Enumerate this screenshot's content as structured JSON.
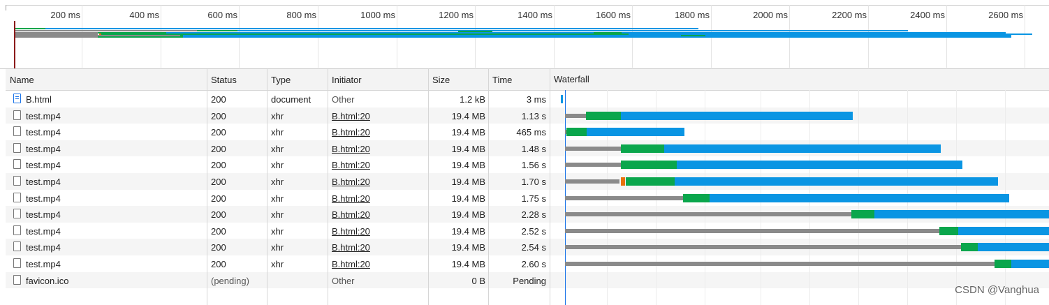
{
  "overview": {
    "ticks": [
      "200 ms",
      "400 ms",
      "600 ms",
      "800 ms",
      "1000 ms",
      "1200 ms",
      "1400 ms",
      "1600 ms",
      "1800 ms",
      "2000 ms",
      "2200 ms",
      "2400 ms",
      "2600 ms"
    ]
  },
  "table": {
    "headers": {
      "name": "Name",
      "status": "Status",
      "type": "Type",
      "initiator": "Initiator",
      "size": "Size",
      "time": "Time",
      "waterfall": "Waterfall"
    },
    "rows": [
      {
        "name": "B.html",
        "status": "200",
        "type": "document",
        "initiator": "Other",
        "initiator_link": false,
        "size": "1.2 kB",
        "time": "3 ms",
        "icon": "document-icon"
      },
      {
        "name": "test.mp4",
        "status": "200",
        "type": "xhr",
        "initiator": "B.html:20",
        "initiator_link": true,
        "size": "19.4 MB",
        "time": "1.13 s",
        "icon": "file-icon"
      },
      {
        "name": "test.mp4",
        "status": "200",
        "type": "xhr",
        "initiator": "B.html:20",
        "initiator_link": true,
        "size": "19.4 MB",
        "time": "465 ms",
        "icon": "file-icon"
      },
      {
        "name": "test.mp4",
        "status": "200",
        "type": "xhr",
        "initiator": "B.html:20",
        "initiator_link": true,
        "size": "19.4 MB",
        "time": "1.48 s",
        "icon": "file-icon"
      },
      {
        "name": "test.mp4",
        "status": "200",
        "type": "xhr",
        "initiator": "B.html:20",
        "initiator_link": true,
        "size": "19.4 MB",
        "time": "1.56 s",
        "icon": "file-icon"
      },
      {
        "name": "test.mp4",
        "status": "200",
        "type": "xhr",
        "initiator": "B.html:20",
        "initiator_link": true,
        "size": "19.4 MB",
        "time": "1.70 s",
        "icon": "file-icon"
      },
      {
        "name": "test.mp4",
        "status": "200",
        "type": "xhr",
        "initiator": "B.html:20",
        "initiator_link": true,
        "size": "19.4 MB",
        "time": "1.75 s",
        "icon": "file-icon"
      },
      {
        "name": "test.mp4",
        "status": "200",
        "type": "xhr",
        "initiator": "B.html:20",
        "initiator_link": true,
        "size": "19.4 MB",
        "time": "2.28 s",
        "icon": "file-icon"
      },
      {
        "name": "test.mp4",
        "status": "200",
        "type": "xhr",
        "initiator": "B.html:20",
        "initiator_link": true,
        "size": "19.4 MB",
        "time": "2.52 s",
        "icon": "file-icon"
      },
      {
        "name": "test.mp4",
        "status": "200",
        "type": "xhr",
        "initiator": "B.html:20",
        "initiator_link": true,
        "size": "19.4 MB",
        "time": "2.54 s",
        "icon": "file-icon"
      },
      {
        "name": "test.mp4",
        "status": "200",
        "type": "xhr",
        "initiator": "B.html:20",
        "initiator_link": true,
        "size": "19.4 MB",
        "time": "2.60 s",
        "icon": "file-icon"
      },
      {
        "name": "favicon.ico",
        "status": "(pending)",
        "type": "",
        "initiator": "Other",
        "initiator_link": false,
        "size": "0 B",
        "time": "Pending",
        "icon": "file-icon"
      }
    ]
  },
  "colors": {
    "queue": "#8a8a8a",
    "waiting": "#0aa64c",
    "download": "#0a95e3",
    "stalled": "#e8710a",
    "start_marker": "#1a73e8",
    "load_marker": "#8b1a1a"
  },
  "watermark": "CSDN @Vanghua"
}
